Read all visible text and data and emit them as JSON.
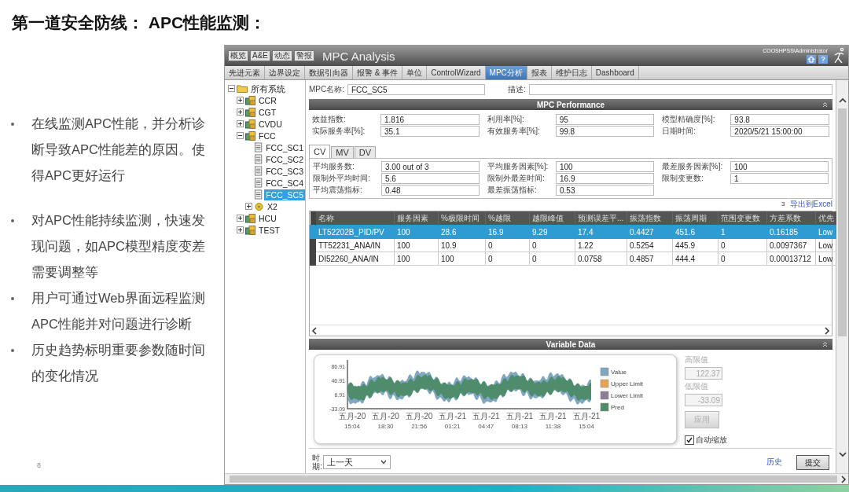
{
  "slide": {
    "title": "第一道安全防线： APC性能监测：",
    "bullets": [
      "在线监测APC性能，并分析诊断导致APC性能差的原因。使得APC更好运行",
      "对APC性能持续监测，快速发现问题，如APC模型精度变差需要调整等",
      "用户可通过Web界面远程监测APC性能并对问题进行诊断",
      "历史趋势标明重要参数随时间的变化情况"
    ],
    "page_number": "8"
  },
  "app": {
    "mini_buttons": [
      "概览",
      "A&E",
      "动态",
      "警报"
    ],
    "title": "MPC Analysis",
    "user": "COOSHPSS\\Administrator",
    "nav_tabs": [
      {
        "label": "先进元素",
        "selected": false
      },
      {
        "label": "边界设定",
        "selected": false
      },
      {
        "label": "数据引向器",
        "selected": false
      },
      {
        "label": "报警 & 事件",
        "selected": false
      },
      {
        "label": "单位",
        "selected": false
      },
      {
        "label": "ControlWizard",
        "selected": false
      },
      {
        "label": "MPC分析",
        "selected": true
      },
      {
        "label": "报表",
        "selected": false
      },
      {
        "label": "维护日志",
        "selected": false
      },
      {
        "label": "Dashboard",
        "selected": false
      }
    ],
    "tree": [
      {
        "label": "所有系统",
        "kind": "root",
        "expanded": true,
        "selected": false,
        "children": [
          {
            "label": "CCR",
            "kind": "unit",
            "expanded": false,
            "selected": false
          },
          {
            "label": "CGT",
            "kind": "unit",
            "expanded": false,
            "selected": false
          },
          {
            "label": "CVDU",
            "kind": "unit",
            "expanded": false,
            "selected": false
          },
          {
            "label": "FCC",
            "kind": "unit",
            "expanded": true,
            "selected": false,
            "children": [
              {
                "label": "FCC_SC1",
                "kind": "controller",
                "selected": false
              },
              {
                "label": "FCC_SC2",
                "kind": "controller",
                "selected": false
              },
              {
                "label": "FCC_SC3",
                "kind": "controller",
                "selected": false
              },
              {
                "label": "FCC_SC4",
                "kind": "controller",
                "selected": false
              },
              {
                "label": "FCC_SC5",
                "kind": "controller",
                "selected": true
              },
              {
                "label": "X2",
                "kind": "group",
                "expanded": false,
                "selected": false
              }
            ]
          },
          {
            "label": "HCU",
            "kind": "unit",
            "expanded": false,
            "selected": false
          },
          {
            "label": "TEST",
            "kind": "unit",
            "expanded": false,
            "selected": false
          }
        ]
      }
    ],
    "mpc_name": {
      "label": "MPC名称:",
      "value": "FCC_SC5"
    },
    "description": {
      "label": "描述:"
    },
    "performance": {
      "title": "MPC Performance",
      "fields": [
        {
          "label": "效益指数:",
          "value": "1.816"
        },
        {
          "label": "利用率[%]:",
          "value": "95"
        },
        {
          "label": "模型精确度[%]:",
          "value": "93.8"
        },
        {
          "label": "实际服务率[%]:",
          "value": "35.1"
        },
        {
          "label": "有效服务率[%]:",
          "value": "99.8"
        },
        {
          "label": "日期时间:",
          "value": "2020/5/21 15:00:00"
        }
      ]
    },
    "sub_tabs": [
      {
        "label": "CV",
        "selected": true
      },
      {
        "label": "MV",
        "selected": false
      },
      {
        "label": "DV",
        "selected": false
      }
    ],
    "cv_fields": [
      {
        "label": "平均服务数:",
        "value": "3.00 out of 3"
      },
      {
        "label": "平均服务因素[%]:",
        "value": "100"
      },
      {
        "label": "最差服务因素[%]:",
        "value": "100"
      },
      {
        "label": "限制外平均时间:",
        "value": "5.6"
      },
      {
        "label": "限制外最差时间:",
        "value": "16.9"
      },
      {
        "label": "限制变更数:",
        "value": "1"
      },
      {
        "label": "平均震荡指标:",
        "value": "0.48"
      },
      {
        "label": "最差振荡指标:",
        "value": "0.53"
      }
    ],
    "table": {
      "count": "3",
      "export_link": "导出到Excel",
      "columns": [
        "名称",
        "服务因素",
        "%极限时间",
        "%越限",
        "越限峰值",
        "预测误差平...",
        "振荡指数",
        "振荡周期",
        "范围变更数",
        "方差系数",
        "优先"
      ],
      "rows": [
        {
          "selected": true,
          "cells": [
            "LT52202B_PID/PV",
            "100",
            "28.6",
            "16.9",
            "9.29",
            "17.4",
            "0.4427",
            "451.6",
            "1",
            "0.16185",
            "Low"
          ]
        },
        {
          "selected": false,
          "cells": [
            "TT52231_ANA/IN",
            "100",
            "10.9",
            "0",
            "0",
            "1.22",
            "0.5254",
            "445.9",
            "0",
            "0.0097367",
            "Low"
          ]
        },
        {
          "selected": false,
          "cells": [
            "DI52260_ANA/IN",
            "100",
            "100",
            "0",
            "0",
            "0.0758",
            "0.4857",
            "444.4",
            "0",
            "0.00013712",
            "Low"
          ]
        }
      ]
    },
    "variable_data": {
      "title": "Variable Data",
      "y_tick_labels": [
        "86.91",
        "46.91",
        "6.91",
        "-33.09"
      ],
      "x_tick_labels": [
        {
          "date": "五月-20",
          "time": "15:04"
        },
        {
          "date": "五月-20",
          "time": "18:30"
        },
        {
          "date": "五月-20",
          "time": "21:56"
        },
        {
          "date": "五月-21",
          "time": "01:21"
        },
        {
          "date": "五月-21",
          "time": "04:47"
        },
        {
          "date": "五月-21",
          "time": "08:13"
        },
        {
          "date": "五月-21",
          "time": "11:38"
        },
        {
          "date": "五月-21",
          "time": "15:04"
        }
      ],
      "legend": [
        {
          "label": "Value",
          "color": "#7fa7c0"
        },
        {
          "label": "Upper Limit",
          "color": "#e6a35a"
        },
        {
          "label": "Lower Limit",
          "color": "#8e7e95"
        },
        {
          "label": "Pred",
          "color": "#4f8c6c"
        }
      ],
      "high_limit": {
        "label": "高限值",
        "value": "122.37",
        "disabled": true
      },
      "low_limit": {
        "label": "低限值",
        "value": "-33.09",
        "disabled": true
      },
      "apply_button": {
        "label": "应用",
        "disabled": true
      },
      "auto_scale": {
        "label": "自动缩放",
        "checked": true
      }
    },
    "footer": {
      "period_label": "时期:",
      "period_value": "上一天",
      "history_link": "历史",
      "submit_button": "提交"
    }
  }
}
